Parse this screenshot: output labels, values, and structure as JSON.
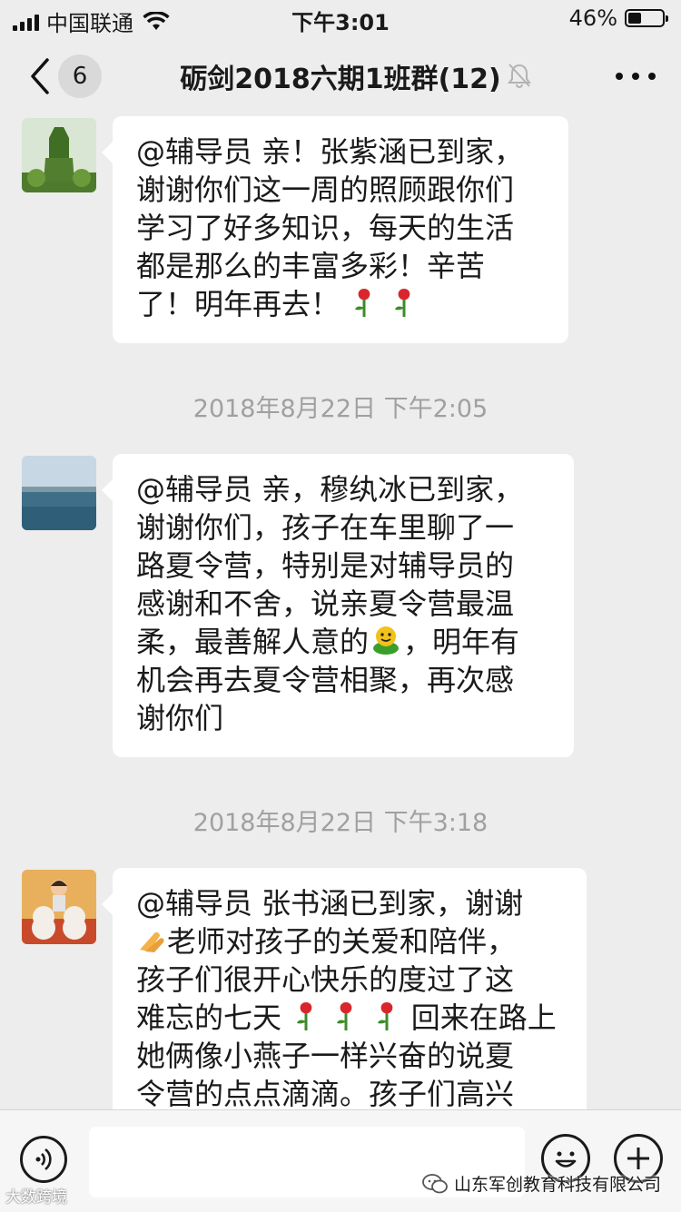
{
  "status_bar": {
    "carrier": "中国联通",
    "time": "下午3:01",
    "battery": "46%",
    "battery_level": 0.46
  },
  "nav": {
    "unread_count": "6",
    "title": "砺剑2018六期1班群(12)"
  },
  "messages": [
    {
      "type": "text",
      "avatar": "garden-photo-avatar",
      "lines": [
        "@辅导员 亲！张紫涵已到家，",
        "谢谢你们这一周的照顾跟你们",
        "学习了好多知识，每天的生活",
        "都是那么的丰富多彩！辛苦",
        "了！明年再去！"
      ],
      "emoji": "rose"
    },
    {
      "type": "time",
      "text": "2018年8月22日 下午2:05"
    },
    {
      "type": "text",
      "avatar": "lake-photo-avatar",
      "lines": [
        "@辅导员 亲，穆纨冰已到家，",
        "谢谢你们，孩子在车里聊了一",
        "路夏令营，特别是对辅导员的",
        "感谢和不舍，说亲夏令营最温",
        "柔，最善解人意的",
        "机会再去夏令营相聚，再次感",
        "谢你们"
      ],
      "line5_after_emoji": "，明年有",
      "emoji": "green-smiley"
    },
    {
      "type": "time",
      "text": "2018年8月22日 下午3:18"
    },
    {
      "type": "text",
      "avatar": "child-teddy-avatar",
      "lines": [
        "@辅导员 张书涵已到家，谢谢",
        "老师对孩子的关爱和陪伴，",
        "孩子们很开心快乐的度过了这",
        "难忘的七天",
        "回来在路上",
        "她俩像小燕子一样兴奋的说夏",
        "令营的点点滴滴。孩子们高兴"
      ],
      "emoji": "rose"
    }
  ],
  "watermarks": {
    "left": "大数跨境",
    "right": "山东军创教育科技有限公司"
  },
  "colors": {
    "background": "#ededed",
    "bubble": "#ffffff",
    "timestamp": "#a0a0a0"
  }
}
